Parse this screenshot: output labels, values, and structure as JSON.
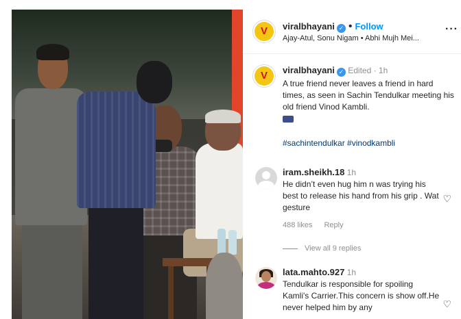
{
  "post": {
    "username": "viralbhayani",
    "follow_label": "Follow",
    "subtitle": "Ajay-Atul, Sonu Nigam • Abhi Mujh Mei...",
    "avatar_letter": "V"
  },
  "caption": {
    "username": "viralbhayani",
    "edited": "Edited",
    "time": "1h",
    "text": "A true friend never leaves a friend in hard times, as seen in Sachin Tendulkar meeting his old friend Vinod Kambli.",
    "hashtags": "#sachintendulkar #vinodkambli"
  },
  "comments": [
    {
      "username": "iram.sheikh.18",
      "time": "1h",
      "text": "He didn’t even hug him n was trying his best to release his hand from his grip . Wat gesture",
      "likes": "488 likes",
      "reply_label": "Reply"
    },
    {
      "username": "lata.mahto.927",
      "time": "1h",
      "text": "Tendulkar is responsible for spoiling Kamli's Carrier.This concern is show off.He never helped him by any"
    }
  ],
  "view_all": "View all 9 replies",
  "icons": {
    "verified": "verified-badge-icon",
    "more": "more-options-icon",
    "heart": "heart-icon"
  },
  "colors": {
    "accent": "#0095f6",
    "verified": "#3897f0",
    "hashtag": "#00376b"
  }
}
